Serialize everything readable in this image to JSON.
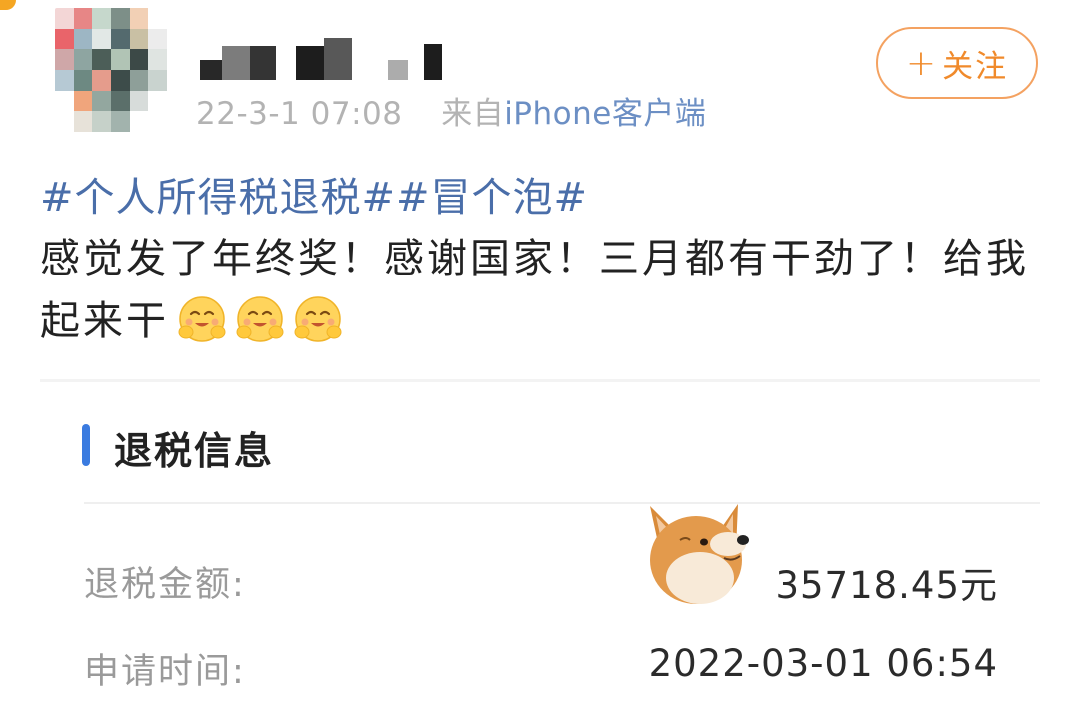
{
  "post": {
    "meta": {
      "timestamp": "22-3-1 07:08",
      "source_prefix": "来自",
      "source": "iPhone客户端"
    },
    "follow_button": {
      "plus": "+",
      "label": "关注"
    },
    "hashtags": "#个人所得税退税##冒个泡#",
    "text": "感觉发了年终奖！感谢国家！三月都有干劲了！给我起来干",
    "emojis": [
      "hug-emoji",
      "hug-emoji",
      "hug-emoji"
    ]
  },
  "refund_card": {
    "title": "退税信息",
    "rows": [
      {
        "label": "退税金额:",
        "value": "35718.45元"
      },
      {
        "label": "申请时间:",
        "value": "2022-03-01 06:54"
      }
    ]
  },
  "colors": {
    "link_blue": "#4a6ea9",
    "follow_orange": "#f08a2b",
    "accent_blue": "#3a7be0"
  }
}
